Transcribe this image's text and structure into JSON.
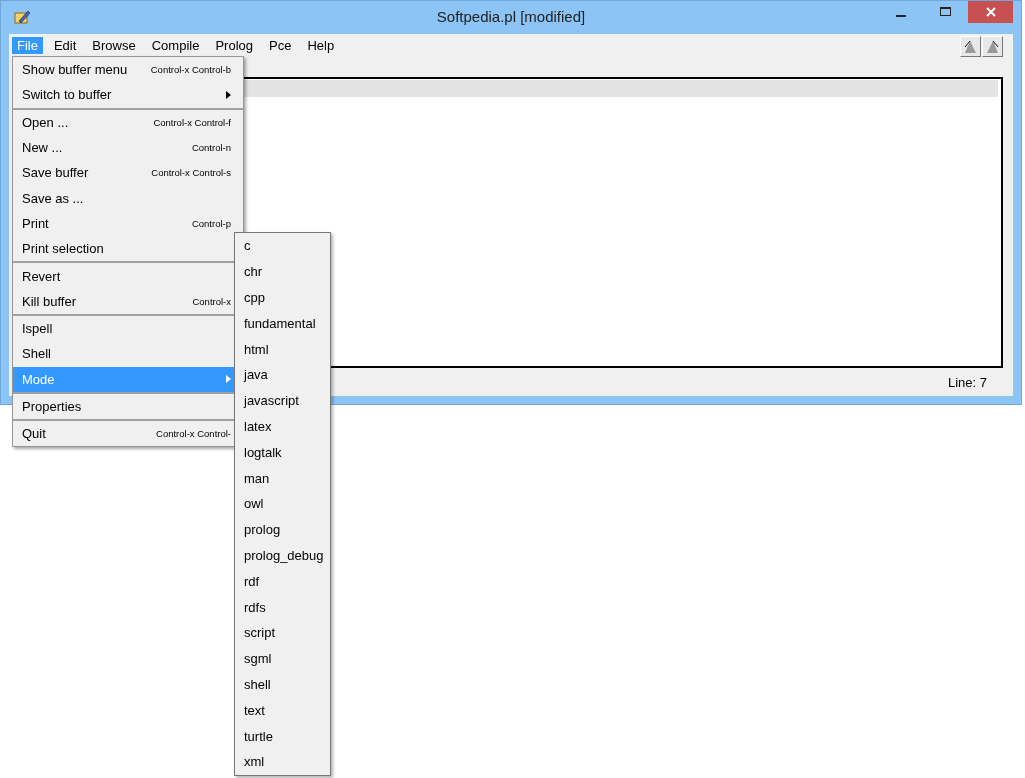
{
  "window": {
    "title": "Softpedia.pl [modified]"
  },
  "menu_bar": [
    {
      "label": "File",
      "selected": true
    },
    {
      "label": "Edit",
      "selected": false
    },
    {
      "label": "Browse",
      "selected": false
    },
    {
      "label": "Compile",
      "selected": false
    },
    {
      "label": "Prolog",
      "selected": false
    },
    {
      "label": "Pce",
      "selected": false
    },
    {
      "label": "Help",
      "selected": false
    }
  ],
  "file_menu": [
    [
      {
        "label": "Show buffer menu",
        "shortcut": "Control-x Control-b",
        "submenu": false,
        "selected": false
      },
      {
        "label": "Switch to buffer",
        "submenu": true,
        "selected": false
      }
    ],
    [
      {
        "label": "Open ...",
        "shortcut": "Control-x Control-f",
        "submenu": false,
        "selected": false
      },
      {
        "label": "New ...",
        "shortcut": "Control-n",
        "submenu": false,
        "selected": false
      },
      {
        "label": "Save buffer",
        "shortcut": "Control-x Control-s",
        "submenu": false,
        "selected": false
      },
      {
        "label": "Save as ...",
        "submenu": false,
        "selected": false
      },
      {
        "label": "Print",
        "shortcut": "Control-p",
        "submenu": false,
        "selected": false
      },
      {
        "label": "Print selection",
        "submenu": false,
        "selected": false
      }
    ],
    [
      {
        "label": "Revert",
        "submenu": false,
        "selected": false
      },
      {
        "label": "Kill buffer",
        "shortcut": "Control-x",
        "submenu": false,
        "selected": false
      }
    ],
    [
      {
        "label": "Ispell",
        "submenu": false,
        "selected": false
      },
      {
        "label": "Shell",
        "submenu": false,
        "selected": false
      },
      {
        "label": "Mode",
        "submenu": true,
        "selected": true
      }
    ],
    [
      {
        "label": "Properties",
        "submenu": false,
        "selected": false
      }
    ],
    [
      {
        "label": "Quit",
        "shortcut": "Control-x Control-",
        "submenu": false,
        "selected": false
      }
    ]
  ],
  "mode_submenu": [
    "c",
    "chr",
    "cpp",
    "fundamental",
    "html",
    "java",
    "javascript",
    "latex",
    "logtalk",
    "man",
    "owl",
    "prolog",
    "prolog_debug",
    "rdf",
    "rdfs",
    "script",
    "sgml",
    "shell",
    "text",
    "turtle",
    "xml"
  ],
  "status_bar": {
    "line": "Line: 7"
  }
}
